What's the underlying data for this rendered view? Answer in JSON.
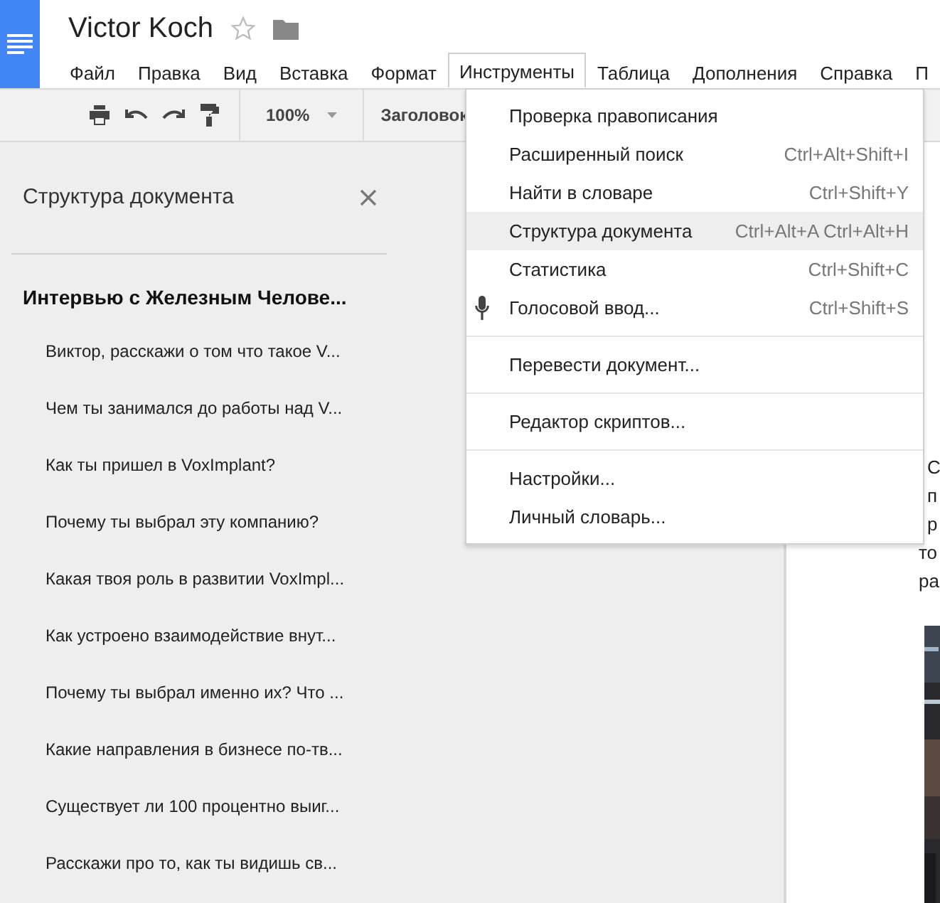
{
  "document": {
    "title": "Victor Koch",
    "starred": false
  },
  "menu_bar": [
    {
      "label": "Файл",
      "selected": false
    },
    {
      "label": "Правка",
      "selected": false
    },
    {
      "label": "Вид",
      "selected": false
    },
    {
      "label": "Вставка",
      "selected": false
    },
    {
      "label": "Формат",
      "selected": false
    },
    {
      "label": "Инструменты",
      "selected": true
    },
    {
      "label": "Таблица",
      "selected": false
    },
    {
      "label": "Дополнения",
      "selected": false
    },
    {
      "label": "Справка",
      "selected": false
    },
    {
      "label": "П",
      "selected": false
    }
  ],
  "toolbar": {
    "zoom": "100%",
    "style": "Заголовок"
  },
  "outline": {
    "title": "Структура документа",
    "heading": "Интервью с Железным Челове...",
    "items": [
      "Виктор, расскажи о том что такое V...",
      "Чем ты занимался до работы над V...",
      "Как ты пришел в VoxImplant?",
      "Почему ты выбрал эту компанию?",
      "Какая твоя роль в развитии VoxImpl...",
      "Как устроено взаимодействие внут...",
      "Почему ты выбрал именно их? Что ...",
      "Какие направления в бизнесе по-тв...",
      "Существует ли 100 процентно выиг...",
      "Расскажи про то, как ты видишь св..."
    ]
  },
  "page_text": [
    "С",
    "п",
    "р",
    "то",
    "ра"
  ],
  "tools_menu": [
    {
      "kind": "item",
      "label": "Проверка правописания",
      "selected": false
    },
    {
      "kind": "item",
      "label": "Расширенный поиск",
      "shortcut": "Ctrl+Alt+Shift+I",
      "selected": false
    },
    {
      "kind": "item",
      "label": "Найти в словаре",
      "shortcut": "Ctrl+Shift+Y",
      "selected": false
    },
    {
      "kind": "item",
      "label": "Структура документа",
      "shortcut": "Ctrl+Alt+A Ctrl+Alt+H",
      "selected": true
    },
    {
      "kind": "item",
      "label": "Статистика",
      "shortcut": "Ctrl+Shift+C",
      "selected": false
    },
    {
      "kind": "mic",
      "label": "Голосовой ввод...",
      "shortcut": "Ctrl+Shift+S",
      "selected": false
    },
    {
      "kind": "separator"
    },
    {
      "kind": "item",
      "label": "Перевести документ...",
      "selected": false
    },
    {
      "kind": "separator"
    },
    {
      "kind": "item",
      "label": "Редактор скриптов...",
      "selected": false
    },
    {
      "kind": "separator"
    },
    {
      "kind": "item",
      "label": "Настройки...",
      "selected": false
    },
    {
      "kind": "item",
      "label": "Личный словарь...",
      "selected": false
    }
  ]
}
